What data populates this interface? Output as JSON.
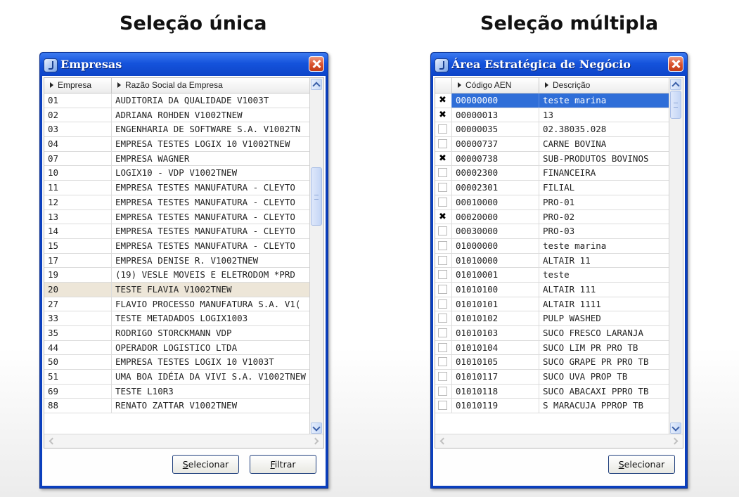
{
  "headings": {
    "left": "Seleção única",
    "right": "Seleção múltipla"
  },
  "empresas": {
    "title": "Empresas",
    "columns": [
      "Empresa",
      "Razão Social da Empresa"
    ],
    "rows": [
      {
        "code": "01",
        "name": "AUDITORIA DA QUALIDADE V1003T"
      },
      {
        "code": "02",
        "name": "ADRIANA ROHDEN V1002TNEW"
      },
      {
        "code": "03",
        "name": "ENGENHARIA DE SOFTWARE S.A. V1002TN"
      },
      {
        "code": "04",
        "name": "EMPRESA TESTES LOGIX 10 V1002TNEW"
      },
      {
        "code": "07",
        "name": "EMPRESA WAGNER"
      },
      {
        "code": "10",
        "name": "LOGIX10 - VDP V1002TNEW"
      },
      {
        "code": "11",
        "name": "EMPRESA TESTES MANUFATURA - CLEYTO"
      },
      {
        "code": "12",
        "name": "EMPRESA TESTES MANUFATURA - CLEYTO"
      },
      {
        "code": "13",
        "name": "EMPRESA TESTES MANUFATURA - CLEYTO"
      },
      {
        "code": "14",
        "name": "EMPRESA TESTES MANUFATURA - CLEYTO"
      },
      {
        "code": "15",
        "name": "EMPRESA TESTES MANUFATURA - CLEYTO"
      },
      {
        "code": "17",
        "name": "EMPRESA DENISE R. V1002TNEW"
      },
      {
        "code": "19",
        "name": "(19) VESLE MOVEIS E ELETRODOM  *PRD"
      },
      {
        "code": "20",
        "name": "TESTE FLAVIA V1002TNEW",
        "selected": true
      },
      {
        "code": "27",
        "name": "FLAVIO PROCESSO MANUFATURA S.A. V1("
      },
      {
        "code": "33",
        "name": "TESTE METADADOS LOGIX1003"
      },
      {
        "code": "35",
        "name": "RODRIGO STORCKMANN VDP"
      },
      {
        "code": "44",
        "name": "OPERADOR LOGISTICO LTDA"
      },
      {
        "code": "50",
        "name": "EMPRESA TESTES LOGIX 10 V1003T"
      },
      {
        "code": "51",
        "name": "UMA BOA IDÉIA DA VIVI S.A. V1002TNEW"
      },
      {
        "code": "69",
        "name": "TESTE L10R3"
      },
      {
        "code": "88",
        "name": "RENATO ZATTAR V1002TNEW"
      }
    ],
    "buttons": {
      "select_u": "S",
      "select_rest": "elecionar",
      "filter_u": "F",
      "filter_rest": "iltrar"
    }
  },
  "aen": {
    "title": "Área Estratégica de Negócio",
    "columns": [
      "Código AEN",
      "Descrição"
    ],
    "check_mark": "✖",
    "rows": [
      {
        "code": "00000000",
        "desc": "teste marina",
        "checked": true,
        "selected": true
      },
      {
        "code": "00000013",
        "desc": "13",
        "checked": true
      },
      {
        "code": "00000035",
        "desc": "02.38035.028",
        "checked": false
      },
      {
        "code": "00000737",
        "desc": "CARNE BOVINA",
        "checked": false
      },
      {
        "code": "00000738",
        "desc": "SUB-PRODUTOS BOVINOS",
        "checked": true
      },
      {
        "code": "00002300",
        "desc": "FINANCEIRA",
        "checked": false
      },
      {
        "code": "00002301",
        "desc": "FILIAL",
        "checked": false
      },
      {
        "code": "00010000",
        "desc": "PRO-01",
        "checked": false
      },
      {
        "code": "00020000",
        "desc": "PRO-02",
        "checked": true
      },
      {
        "code": "00030000",
        "desc": "PRO-03",
        "checked": false
      },
      {
        "code": "01000000",
        "desc": "teste marina",
        "checked": false
      },
      {
        "code": "01010000",
        "desc": "ALTAIR 11",
        "checked": false
      },
      {
        "code": "01010001",
        "desc": "teste",
        "checked": false
      },
      {
        "code": "01010100",
        "desc": "ALTAIR 111",
        "checked": false
      },
      {
        "code": "01010101",
        "desc": "ALTAIR 1111",
        "checked": false
      },
      {
        "code": "01010102",
        "desc": "PULP WASHED",
        "checked": false
      },
      {
        "code": "01010103",
        "desc": "SUCO FRESCO LARANJA",
        "checked": false
      },
      {
        "code": "01010104",
        "desc": "SUCO LIM PR PRO TB",
        "checked": false
      },
      {
        "code": "01010105",
        "desc": "SUCO GRAPE PR PRO TB",
        "checked": false
      },
      {
        "code": "01010117",
        "desc": "SUCO UVA PROP TB",
        "checked": false
      },
      {
        "code": "01010118",
        "desc": "SUCO ABACAXI PPRO TB",
        "checked": false
      },
      {
        "code": "01010119",
        "desc": "S MARACUJA PPROP TB",
        "checked": false
      }
    ],
    "buttons": {
      "select_u": "S",
      "select_rest": "elecionar"
    }
  },
  "colors": {
    "title_blue": "#1553dc",
    "selection_blue": "#2f6ed8",
    "selection_light": "#ede6d8",
    "close_red": "#d8502c"
  }
}
